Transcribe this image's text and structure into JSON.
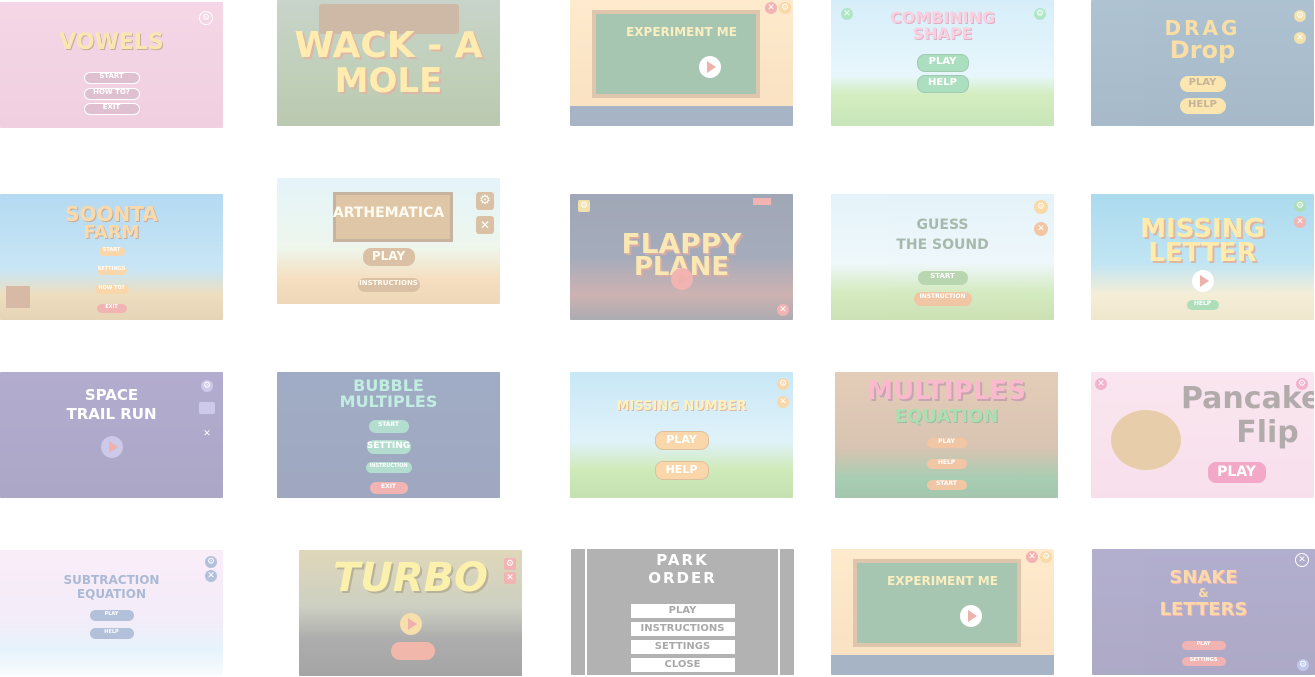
{
  "games": [
    {
      "title": "VOWELS",
      "buttons": [
        "START",
        "HOW TO?",
        "EXIT"
      ]
    },
    {
      "title_line1": "WACK - A",
      "title_line2": "MOLE"
    },
    {
      "title": "EXPERIMENT ME"
    },
    {
      "title_line1": "COMBINING",
      "title_line2": "SHAPE",
      "buttons": [
        "PLAY",
        "HELP"
      ]
    },
    {
      "title_line1": "DRAG",
      "title_line2": "Drop",
      "buttons": [
        "PLAY",
        "HELP"
      ]
    },
    {
      "title_line1": "SOONTA",
      "title_line2": "FARM",
      "buttons": [
        "START",
        "SETTINGS",
        "HOW TO?",
        "EXIT"
      ]
    },
    {
      "title": "ARTHEMATICA",
      "buttons": [
        "PLAY",
        "INSTRUCTIONS"
      ]
    },
    {
      "title_line1": "FLAPPY",
      "title_line2": "PLANE"
    },
    {
      "title_line1": "GUESS",
      "title_line2": "THE SOUND",
      "buttons": [
        "START",
        "INSTRUCTION"
      ]
    },
    {
      "title_line1": "MISSING",
      "title_line2": "LETTER",
      "buttons": [
        "HELP"
      ]
    },
    {
      "title_line1": "SPACE",
      "title_line2": "TRAIL RUN"
    },
    {
      "title_line1": "BUBBLE",
      "title_line2": "MULTIPLES",
      "buttons": [
        "START",
        "SETTING",
        "INSTRUCTION",
        "EXIT"
      ]
    },
    {
      "title": "MISSING NUMBER",
      "buttons": [
        "PLAY",
        "HELP"
      ]
    },
    {
      "title_line1": "MULTIPLES",
      "title_line2": "EQUATION",
      "buttons": [
        "PLAY",
        "HELP",
        "START"
      ]
    },
    {
      "title_line1": "Pancake",
      "title_line2": "Flip",
      "buttons": [
        "PLAY"
      ]
    },
    {
      "title_line1": "SUBTRACTION",
      "title_line2": "EQUATION",
      "buttons": [
        "PLAY",
        "HELP"
      ]
    },
    {
      "title": "TURBO"
    },
    {
      "title_line1": "PARK",
      "title_line2": "ORDER",
      "buttons": [
        "PLAY",
        "INSTRUCTIONS",
        "SETTINGS",
        "CLOSE"
      ]
    },
    {
      "title": "EXPERIMENT ME"
    },
    {
      "title_line1": "SNAKE",
      "title_line2": "&",
      "title_line3": "LETTERS",
      "buttons": [
        "PLAY",
        "SETTINGS"
      ]
    }
  ],
  "icons": {
    "settings": "⚙",
    "close": "✕",
    "play": "▶"
  },
  "colors": {
    "pink_bg": "#e9a6c6",
    "sky_blue": "#8ecbe9",
    "grass_green": "#7cc35a",
    "chalkboard": "#2f7a4a",
    "space_purple": "#4a3b8f",
    "gold_title": "#f5b325",
    "red_accent": "#e24b4b"
  }
}
